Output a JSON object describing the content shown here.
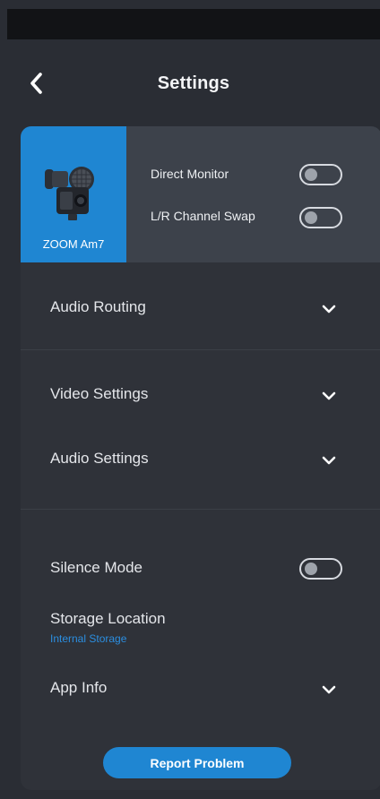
{
  "header": {
    "title": "Settings"
  },
  "device": {
    "name": "ZOOM Am7",
    "direct_monitor_label": "Direct Monitor",
    "channel_swap_label": "L/R Channel Swap",
    "direct_monitor_on": false,
    "channel_swap_on": false
  },
  "sections": {
    "audio_routing": "Audio Routing",
    "video_settings": "Video Settings",
    "audio_settings": "Audio Settings",
    "silence_mode": "Silence Mode",
    "storage_location": "Storage Location",
    "storage_location_value": "Internal Storage",
    "app_info": "App Info",
    "silence_mode_on": false
  },
  "actions": {
    "report_problem": "Report Problem"
  },
  "colors": {
    "accent": "#1f86d2",
    "background": "#2a2d34",
    "card": "#2f3239",
    "device_panel": "#3d424b",
    "status_bar": "#121316"
  }
}
